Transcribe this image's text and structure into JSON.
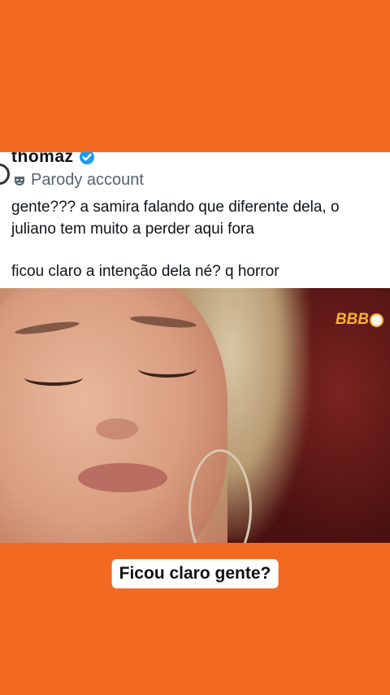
{
  "tweet": {
    "username": "thomaz",
    "label": "Parody account",
    "lines": [
      "gente??? a samira falando que diferente dela, o",
      "juliano tem muito a perder aqui fora",
      "ficou claro a intenção dela né? q horror"
    ]
  },
  "video": {
    "logo_text": "BBB"
  },
  "caption": {
    "text": "Ficou claro gente?"
  },
  "colors": {
    "background": "#f26a22",
    "verified": "#1d9bf0",
    "logo": "#f5b22c"
  },
  "icons": [
    "verified-badge-icon",
    "parody-mask-icon"
  ]
}
